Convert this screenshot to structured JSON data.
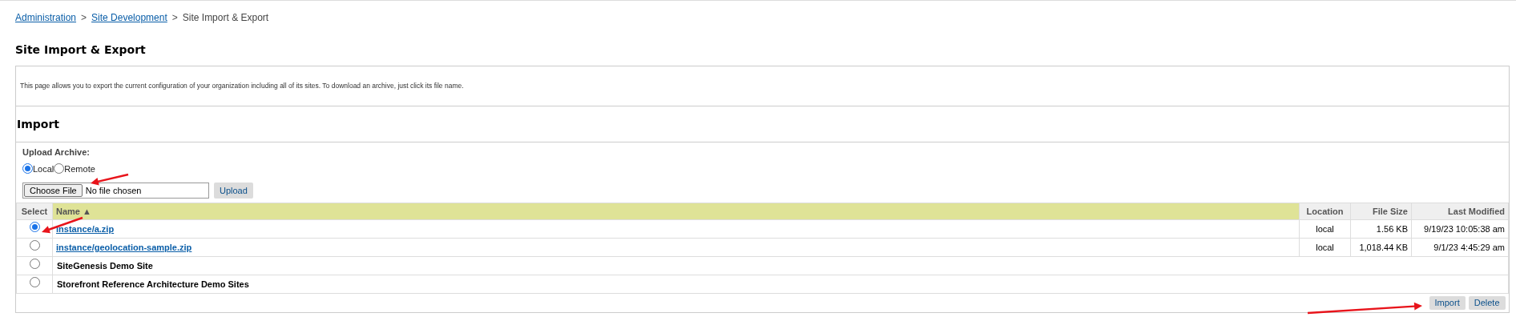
{
  "breadcrumb": [
    {
      "label": "Administration",
      "link": true,
      "separator": ">"
    },
    {
      "label": "Site Development",
      "link": true,
      "separator": ">"
    },
    {
      "label": "Site Import & Export",
      "link": false
    }
  ],
  "title": "Site Import & Export",
  "description": "This page allows you to export the current configuration of your organization including all of its sites. To download an archive, just click its file name.",
  "import": {
    "heading": "Import",
    "upload_label": "Upload Archive:",
    "sources": [
      {
        "label": "Local",
        "selected": true
      },
      {
        "label": "Remote",
        "selected": false
      }
    ],
    "file_button": "Choose File",
    "file_status": "No file chosen",
    "upload_button": "Upload"
  },
  "table": {
    "columns": [
      {
        "label": "Select",
        "sorted": false
      },
      {
        "label": "Name ▲",
        "sorted": true
      },
      {
        "label": "Location",
        "sorted": false
      },
      {
        "label": "File Size",
        "sorted": false
      },
      {
        "label": "Last Modified",
        "sorted": false
      }
    ],
    "rows": [
      {
        "kind": "link",
        "selected": true,
        "name": "instance/a.zip",
        "location": "local",
        "size": "1.56 KB",
        "modified": "9/19/23 10:05:38 am"
      },
      {
        "kind": "link",
        "selected": false,
        "name": "instance/geolocation-sample.zip",
        "location": "local",
        "size": "1,018.44 KB",
        "modified": "9/1/23 4:45:29 am"
      },
      {
        "kind": "site",
        "selected": false,
        "name": "SiteGenesis Demo Site"
      },
      {
        "kind": "site",
        "selected": false,
        "name": "Storefront Reference Architecture Demo Sites"
      }
    ],
    "buttons": [
      "Import",
      "Delete"
    ]
  }
}
